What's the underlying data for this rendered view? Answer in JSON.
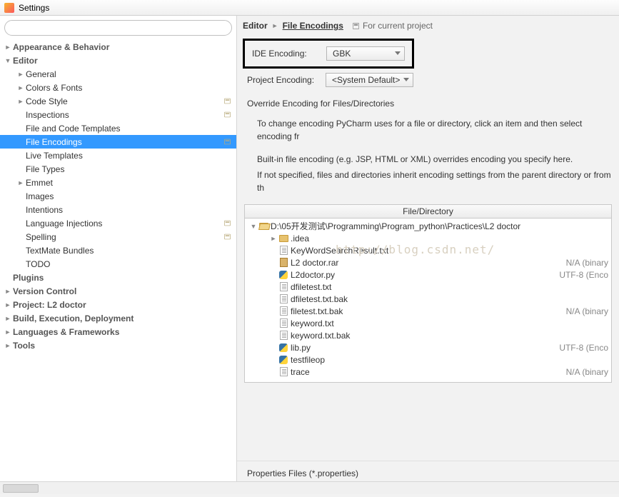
{
  "title": "Settings",
  "search": {
    "placeholder": ""
  },
  "sidebar": {
    "items": [
      {
        "label": "Appearance & Behavior",
        "bold": true,
        "indent": 0,
        "expander": "►"
      },
      {
        "label": "Editor",
        "bold": true,
        "indent": 0,
        "expander": "▼"
      },
      {
        "label": "General",
        "indent": 1,
        "expander": "►"
      },
      {
        "label": "Colors & Fonts",
        "indent": 1,
        "expander": "►"
      },
      {
        "label": "Code Style",
        "indent": 1,
        "expander": "►",
        "badge": true
      },
      {
        "label": "Inspections",
        "indent": 1,
        "badge": true
      },
      {
        "label": "File and Code Templates",
        "indent": 1
      },
      {
        "label": "File Encodings",
        "indent": 1,
        "selected": true,
        "badge": true
      },
      {
        "label": "Live Templates",
        "indent": 1
      },
      {
        "label": "File Types",
        "indent": 1
      },
      {
        "label": "Emmet",
        "indent": 1,
        "expander": "►"
      },
      {
        "label": "Images",
        "indent": 1
      },
      {
        "label": "Intentions",
        "indent": 1
      },
      {
        "label": "Language Injections",
        "indent": 1,
        "badge": true
      },
      {
        "label": "Spelling",
        "indent": 1,
        "badge": true
      },
      {
        "label": "TextMate Bundles",
        "indent": 1
      },
      {
        "label": "TODO",
        "indent": 1
      },
      {
        "label": "Plugins",
        "bold": true,
        "indent": 0
      },
      {
        "label": "Version Control",
        "bold": true,
        "indent": 0,
        "expander": "►"
      },
      {
        "label": "Project: L2 doctor",
        "bold": true,
        "indent": 0,
        "expander": "►"
      },
      {
        "label": "Build, Execution, Deployment",
        "bold": true,
        "indent": 0,
        "expander": "►"
      },
      {
        "label": "Languages & Frameworks",
        "bold": true,
        "indent": 0,
        "expander": "►"
      },
      {
        "label": "Tools",
        "bold": true,
        "indent": 0,
        "expander": "►"
      }
    ]
  },
  "breadcrumb": {
    "root": "Editor",
    "leaf": "File Encodings",
    "scope": "For current project"
  },
  "form": {
    "ide_label": "IDE Encoding:",
    "ide_value": "GBK",
    "project_label": "Project Encoding:",
    "project_value": "<System Default>"
  },
  "override_heading": "Override Encoding for Files/Directories",
  "desc1": "To change encoding PyCharm uses for a file or directory, click an item and then select encoding fr",
  "desc2": "Built-in file encoding (e.g. JSP, HTML or XML) overrides encoding you specify here.",
  "desc3": "If not specified, files and directories inherit encoding settings from the parent directory or from th",
  "table": {
    "header": "File/Directory",
    "root": "D:\\05开发测试\\Programming\\Program_python\\Practices\\L2 doctor",
    "rows": [
      {
        "name": ".idea",
        "type": "folder",
        "indent": 2,
        "expander": "►"
      },
      {
        "name": "KeyWordSearchResult.txt",
        "type": "txt",
        "indent": 2
      },
      {
        "name": "L2 doctor.rar",
        "type": "rar",
        "indent": 2,
        "enc": "N/A (binary"
      },
      {
        "name": "L2doctor.py",
        "type": "py",
        "indent": 2,
        "enc": "UTF-8 (Enco"
      },
      {
        "name": "dfiletest.txt",
        "type": "txt",
        "indent": 2
      },
      {
        "name": "dfiletest.txt.bak",
        "type": "txt",
        "indent": 2
      },
      {
        "name": "filetest.txt.bak",
        "type": "txt",
        "indent": 2,
        "enc": "N/A (binary"
      },
      {
        "name": "keyword.txt",
        "type": "txt",
        "indent": 2
      },
      {
        "name": "keyword.txt.bak",
        "type": "txt",
        "indent": 2
      },
      {
        "name": "lib.py",
        "type": "py",
        "indent": 2,
        "enc": "UTF-8 (Enco"
      },
      {
        "name": "testfileop",
        "type": "py",
        "indent": 2
      },
      {
        "name": "trace",
        "type": "txt",
        "indent": 2,
        "enc": "N/A (binary"
      }
    ]
  },
  "properties_label": "Properties Files (*.properties)",
  "watermark": "http://blog.csdn.net/"
}
